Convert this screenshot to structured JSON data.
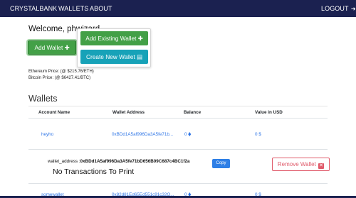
{
  "nav": {
    "brand": "CRYSTALBANK",
    "links": [
      "WALLETS",
      "ABOUT"
    ],
    "logout": "LOGOUT"
  },
  "welcome": "Welcome, phwizard",
  "buttons": {
    "add_wallet": "Add Wallet",
    "add_existing": "Add Existing Wallet",
    "create_new": "Create New Wallet"
  },
  "prices": {
    "ethereum": "Ethereum Price: (@ $215.76/ETH)",
    "bitcoin": "Bitcoin Price: (@ $6427.41/BTC)"
  },
  "wallets": {
    "title": "Wallets",
    "columns": [
      "Account Name",
      "Wallet Address",
      "Balance",
      "Value in USD"
    ],
    "rows": [
      {
        "name": "heyho",
        "address": "0xBDd1A5af996Da3A5fe71b...",
        "balance": "0",
        "usd": "0"
      },
      {
        "name": "somewallet",
        "address": "0x82d81Ed65Ed551c91c32O...",
        "balance": "0",
        "usd": "0"
      }
    ],
    "detail": {
      "label": "wallet_address :",
      "value": "0xBDd1A5af996Da3A5fe71bD656B09C687c4BC1f2a",
      "copy": "Copy",
      "remove": "Remove Wallet",
      "empty": "No Transactions To Print"
    },
    "usd_symbol": "$"
  },
  "colors": {
    "navbar": "#1b2150",
    "success": "#43a047",
    "info": "#17a2b8",
    "link": "#2e75e6",
    "danger": "#e05a6a"
  },
  "icons": [
    "plus-icon",
    "wallet-icon",
    "logout-icon",
    "ethereum-icon",
    "close-icon"
  ]
}
